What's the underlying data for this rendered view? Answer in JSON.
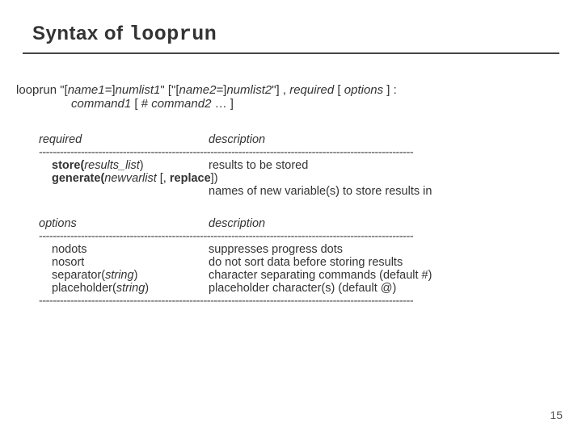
{
  "title": {
    "prefix": "Syntax of ",
    "cmd": "looprun"
  },
  "syntax": {
    "line1_parts": {
      "cmd": "looprun ",
      "q1": "\"[",
      "n1": "name1=",
      "q1b": "]",
      "nl1": "numlist1",
      "q1c": "\" ",
      "opn": "[\"[",
      "n2": "name2=",
      "mid": "]",
      "nl2": "numlist2",
      "cls": "\"] , ",
      "req": "required",
      "sp1": " [ ",
      "opt": "options",
      "end": " ] :"
    },
    "line2_parts": {
      "c1": "command1",
      "sp": " [ # ",
      "c2": "command2",
      "dots": " … ]"
    }
  },
  "required": {
    "head_left": "required",
    "head_right": "description",
    "rows": [
      {
        "label_bold": "store(",
        "label_ital": "results_list",
        "label_tail": ")",
        "desc": "results to be stored"
      }
    ],
    "gen_label": {
      "a": "generate(",
      "b": "newvarlist",
      "c": " [, ",
      "d": "replace",
      "e": "])"
    },
    "gen_desc": "names of new variable(s) to store results in"
  },
  "options": {
    "head_left": "options",
    "head_right": "description",
    "rows": [
      {
        "label": "nodots",
        "desc": "suppresses progress dots"
      },
      {
        "label": "nosort",
        "desc": "do not sort data before storing results"
      },
      {
        "label_plain": "separator(",
        "label_ital": "string",
        "label_tail": ")",
        "desc": "character separating commands (default #)"
      },
      {
        "label_plain": "placeholder(",
        "label_ital": "string",
        "label_tail": ")",
        "desc": "placeholder character(s) (default @)"
      }
    ]
  },
  "dashes": "-----------------------------------------------------------------------------------------------------------",
  "page": "15"
}
